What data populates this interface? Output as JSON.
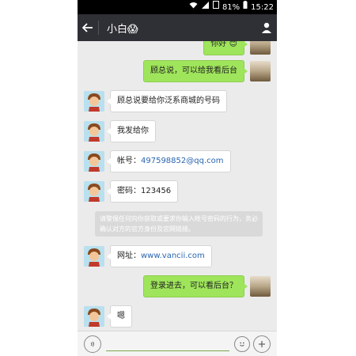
{
  "status": {
    "battery": "81%",
    "time": "15:22"
  },
  "header": {
    "title": "小白😱"
  },
  "messages": {
    "m0": {
      "text": "你好 😊"
    },
    "m1": {
      "text": "顾总说，可以给我看后台"
    },
    "m2": {
      "text": "顾总说要给你泛系商城的号码"
    },
    "m3": {
      "text": "我发给你"
    },
    "m4": {
      "label": "帐号：",
      "value": "497598852@qq.com"
    },
    "m5": {
      "text": "密码：123456"
    },
    "m6": {
      "label": "网址：",
      "value": "www.vancii.com"
    },
    "m7": {
      "text": "登录进去，可以看后台？"
    },
    "m8": {
      "text": "嗯"
    }
  },
  "notice": {
    "text": "请警惕任何向你获取或要求你输入帐号密码的行为，务必确认对方的官方身份及官网链接。"
  },
  "icons": {
    "back": "back-arrow-icon",
    "contact": "person-icon",
    "voice": "voice-icon",
    "emoji": "emoji-icon",
    "more": "plus-icon"
  }
}
